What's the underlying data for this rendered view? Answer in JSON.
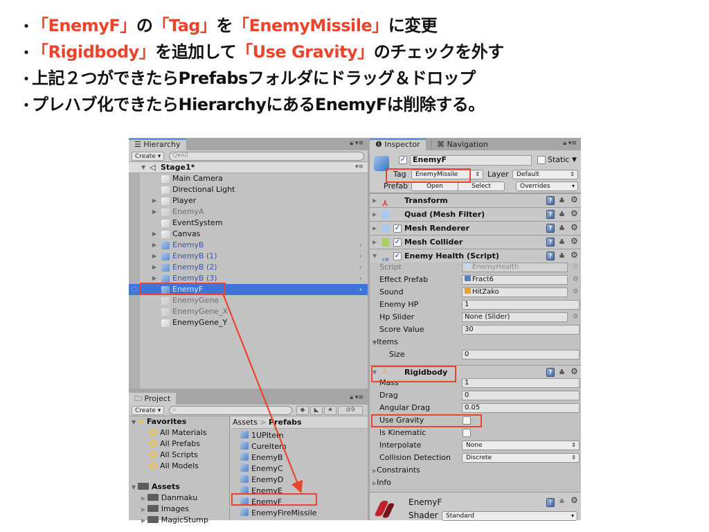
{
  "slide": {
    "bullets": [
      {
        "parts": [
          {
            "text": "「EnemyF」",
            "red": true
          },
          {
            "text": "の",
            "red": false
          },
          {
            "text": "「Tag」",
            "red": true
          },
          {
            "text": "を",
            "red": false
          },
          {
            "text": "「EnemyMissile」",
            "red": true
          },
          {
            "text": "に変更",
            "red": false
          }
        ]
      },
      {
        "parts": [
          {
            "text": "「Rigidbody」",
            "red": true
          },
          {
            "text": "を追加して",
            "red": false
          },
          {
            "text": "「Use Gravity」",
            "red": true
          },
          {
            "text": "のチェックを外す",
            "red": false
          }
        ]
      },
      {
        "parts": [
          {
            "text": "上記２つができたらPrefabsフォルダにドラッグ＆ドロップ",
            "red": false
          }
        ]
      },
      {
        "parts": [
          {
            "text": "プレハブ化できたらHierarchyにあるEnemyFは削除する。",
            "red": false
          }
        ]
      }
    ],
    "bullet_symbol": "・",
    "accent_color": "#e8452c"
  },
  "hierarchy": {
    "tab_label": "Hierarchy",
    "create_label": "Create ▾",
    "search_placeholder": "Q▾All",
    "scene_name": "Stage1*",
    "items": [
      {
        "label": "Main Camera",
        "expandable": false,
        "type": "normal"
      },
      {
        "label": "Directional Light",
        "expandable": false,
        "type": "normal"
      },
      {
        "label": "Player",
        "expandable": true,
        "type": "normal"
      },
      {
        "label": "EnemyA",
        "expandable": true,
        "type": "disabled"
      },
      {
        "label": "EventSystem",
        "expandable": false,
        "type": "normal"
      },
      {
        "label": "Canvas",
        "expandable": true,
        "type": "normal"
      },
      {
        "label": "EnemyB",
        "expandable": true,
        "type": "prefab"
      },
      {
        "label": "EnemyB (1)",
        "expandable": true,
        "type": "prefab"
      },
      {
        "label": "EnemyB (2)",
        "expandable": true,
        "type": "prefab"
      },
      {
        "label": "EnemyB (3)",
        "expandable": true,
        "type": "prefab"
      },
      {
        "label": "EnemyF",
        "expandable": false,
        "type": "selected"
      },
      {
        "label": "EnemyGene",
        "expandable": false,
        "type": "disabled"
      },
      {
        "label": "EnemyGene_X",
        "expandable": false,
        "type": "disabled"
      },
      {
        "label": "EnemyGene_Y",
        "expandable": false,
        "type": "normal"
      }
    ]
  },
  "project": {
    "tab_label": "Project",
    "create_label": "Create ▾",
    "hidden_count": "9",
    "favorites_label": "Favorites",
    "favorites": [
      "All Materials",
      "All Prefabs",
      "All Scripts",
      "All Models"
    ],
    "assets_label": "Assets",
    "asset_folders": [
      "Danmaku",
      "Images",
      "MagicStump"
    ],
    "breadcrumb": {
      "root": "Assets",
      "separator": ">",
      "current": "Prefabs"
    },
    "prefabs": [
      "1UPItem",
      "CureItem",
      "EnemyB",
      "EnemyC",
      "EnemyD",
      "EnemyE",
      "EnemyF",
      "EnemyFireMissile"
    ]
  },
  "inspector": {
    "tab_label": "Inspector",
    "nav_tab_label": "Navigation",
    "object_name": "EnemyF",
    "active": true,
    "static_label": "Static",
    "static_checked": false,
    "tag_label": "Tag",
    "tag_value": "EnemyMissile",
    "layer_label": "Layer",
    "layer_value": "Default",
    "prefab_label": "Prefab",
    "open_label": "Open",
    "select_label": "Select",
    "overrides_label": "Overrides",
    "components": [
      {
        "name": "Transform",
        "has_checkbox": false
      },
      {
        "name": "Quad (Mesh Filter)",
        "has_checkbox": false
      },
      {
        "name": "Mesh Renderer",
        "has_checkbox": true
      },
      {
        "name": "Mesh Collider",
        "has_checkbox": true
      },
      {
        "name": "Enemy Health (Script)",
        "has_checkbox": true
      }
    ],
    "enemy_health": {
      "script_label": "Script",
      "script_value": "EnemyHealth",
      "effect_prefab_label": "Effect Prefab",
      "effect_prefab_value": "Fract6",
      "sound_label": "Sound",
      "sound_value": "HitZako",
      "enemy_hp_label": "Enemy HP",
      "enemy_hp_value": "1",
      "hp_slider_label": "Hp Slider",
      "hp_slider_value": "None (Slider)",
      "score_value_label": "Score Value",
      "score_value_value": "30",
      "items_label": "Items",
      "size_label": "Size",
      "size_value": "0"
    },
    "rigidbody": {
      "title": "Rigidbody",
      "mass_label": "Mass",
      "mass_value": "1",
      "drag_label": "Drag",
      "drag_value": "0",
      "angular_drag_label": "Angular Drag",
      "angular_drag_value": "0.05",
      "use_gravity_label": "Use Gravity",
      "use_gravity": false,
      "is_kinematic_label": "Is Kinematic",
      "is_kinematic": false,
      "interpolate_label": "Interpolate",
      "interpolate_value": "None",
      "collision_label": "Collision Detection",
      "collision_value": "Discrete",
      "constraints_label": "Constraints",
      "info_label": "Info"
    },
    "material": {
      "name": "EnemyF",
      "shader_label": "Shader",
      "shader_value": "Standard"
    }
  }
}
